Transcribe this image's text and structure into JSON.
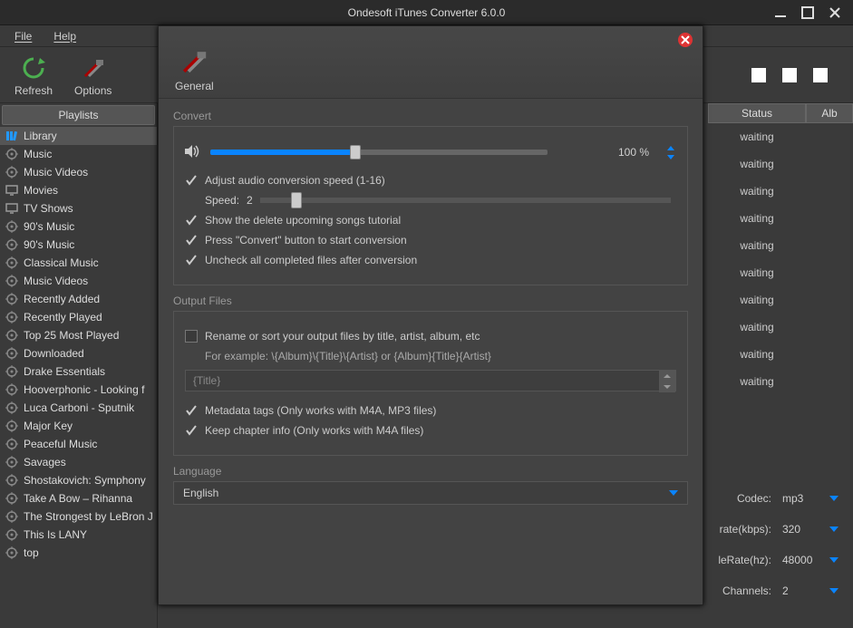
{
  "app_title": "Ondesoft iTunes Converter 6.0.0",
  "menus": {
    "file": "File",
    "help": "Help"
  },
  "toolbar": {
    "refresh": "Refresh",
    "options": "Options"
  },
  "sidebar": {
    "header": "Playlists",
    "items": [
      {
        "label": "Library",
        "icon": "library"
      },
      {
        "label": "Music",
        "icon": "gear"
      },
      {
        "label": "Music Videos",
        "icon": "gear"
      },
      {
        "label": "Movies",
        "icon": "screen"
      },
      {
        "label": "TV Shows",
        "icon": "screen"
      },
      {
        "label": "90's Music",
        "icon": "gear"
      },
      {
        "label": "90's Music",
        "icon": "gear"
      },
      {
        "label": "Classical Music",
        "icon": "gear"
      },
      {
        "label": "Music Videos",
        "icon": "gear"
      },
      {
        "label": "Recently Added",
        "icon": "gear"
      },
      {
        "label": "Recently Played",
        "icon": "gear"
      },
      {
        "label": "Top 25 Most Played",
        "icon": "gear"
      },
      {
        "label": "Downloaded",
        "icon": "gear"
      },
      {
        "label": "Drake Essentials",
        "icon": "gear"
      },
      {
        "label": "Hooverphonic - Looking f",
        "icon": "gear"
      },
      {
        "label": "Luca Carboni - Sputnik",
        "icon": "gear"
      },
      {
        "label": "Major Key",
        "icon": "gear"
      },
      {
        "label": "Peaceful Music",
        "icon": "gear"
      },
      {
        "label": "Savages",
        "icon": "gear"
      },
      {
        "label": "Shostakovich: Symphony",
        "icon": "gear"
      },
      {
        "label": "Take A Bow – Rihanna",
        "icon": "gear"
      },
      {
        "label": "The Strongest by LeBron J",
        "icon": "gear"
      },
      {
        "label": "This Is LANY",
        "icon": "gear"
      },
      {
        "label": "top",
        "icon": "gear"
      }
    ]
  },
  "right": {
    "status_header": "Status",
    "album_header": "Alb",
    "status_values": [
      "waiting",
      "waiting",
      "waiting",
      "waiting",
      "waiting",
      "waiting",
      "waiting",
      "waiting",
      "waiting",
      "waiting"
    ],
    "settings": {
      "codec_label": "Codec:",
      "codec_value": "mp3",
      "rate_label": "rate(kbps):",
      "rate_value": "320",
      "srate_label": "leRate(hz):",
      "srate_value": "48000",
      "channels_label": "Channels:",
      "channels_value": "2"
    }
  },
  "modal": {
    "tab_general": "General",
    "convert": {
      "title": "Convert",
      "volume_pct": "100 %",
      "adjust_speed": "Adjust audio conversion speed (1-16)",
      "speed_label": "Speed:",
      "speed_value": "2",
      "show_tutorial": "Show the delete upcoming songs tutorial",
      "press_convert": "Press \"Convert\" button to start conversion",
      "uncheck_completed": "Uncheck all completed files after conversion"
    },
    "output": {
      "title": "Output Files",
      "rename_label": "Rename or sort your output files by title, artist, album, etc",
      "example": "For example: \\{Album}\\{Title}\\{Artist} or {Album}{Title}{Artist}",
      "pattern_placeholder": "{Title}",
      "metadata": "Metadata tags (Only works with M4A, MP3 files)",
      "chapter": "Keep chapter info (Only works with M4A files)"
    },
    "language": {
      "title": "Language",
      "value": "English"
    }
  }
}
